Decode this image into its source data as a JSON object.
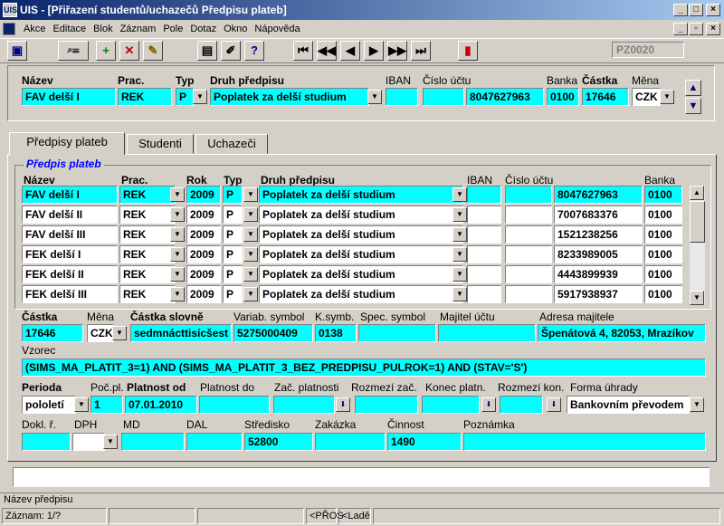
{
  "window": {
    "title": "UIS - [Přiřazení studentů/uchazečů Předpisu plateb]",
    "icon": "UIS"
  },
  "menu": [
    "Akce",
    "Editace",
    "Blok",
    "Záznam",
    "Pole",
    "Dotaz",
    "Okno",
    "Nápověda"
  ],
  "toolbar": {
    "form_code": "PZ0020"
  },
  "header": {
    "labels": {
      "nazev": "Název",
      "prac": "Prac.",
      "typ": "Typ",
      "druh": "Druh předpisu",
      "iban": "IBAN",
      "cislo": "Číslo účtu",
      "banka": "Banka",
      "castka": "Částka",
      "mena": "Měna"
    },
    "values": {
      "nazev": "FAV delší I",
      "prac": "REK",
      "typ": "P",
      "druh": "Poplatek za delší studium",
      "iban": "",
      "cislo": "8047627963",
      "banka": "0100",
      "castka": "17646",
      "mena": "CZK"
    }
  },
  "tabs": [
    "Předpisy plateb",
    "Studenti",
    "Uchazeči"
  ],
  "group_title": "Předpis plateb",
  "grid": {
    "headers": {
      "nazev": "Název",
      "prac": "Prac.",
      "rok": "Rok",
      "typ": "Typ",
      "druh": "Druh předpisu",
      "iban": "IBAN",
      "cislo": "Číslo účtu",
      "banka": "Banka"
    },
    "rows": [
      {
        "nazev": "FAV delší I",
        "prac": "REK",
        "rok": "2009",
        "typ": "P",
        "druh": "Poplatek za delší studium",
        "iban": "",
        "cislo": "8047627963",
        "banka": "0100"
      },
      {
        "nazev": "FAV delší II",
        "prac": "REK",
        "rok": "2009",
        "typ": "P",
        "druh": "Poplatek za delší studium",
        "iban": "",
        "cislo": "7007683376",
        "banka": "0100"
      },
      {
        "nazev": "FAV delší III",
        "prac": "REK",
        "rok": "2009",
        "typ": "P",
        "druh": "Poplatek za delší studium",
        "iban": "",
        "cislo": "1521238256",
        "banka": "0100"
      },
      {
        "nazev": "FEK delší I",
        "prac": "REK",
        "rok": "2009",
        "typ": "P",
        "druh": "Poplatek za delší studium",
        "iban": "",
        "cislo": "8233989005",
        "banka": "0100"
      },
      {
        "nazev": "FEK delší II",
        "prac": "REK",
        "rok": "2009",
        "typ": "P",
        "druh": "Poplatek za delší studium",
        "iban": "",
        "cislo": "4443899939",
        "banka": "0100"
      },
      {
        "nazev": "FEK delší III",
        "prac": "REK",
        "rok": "2009",
        "typ": "P",
        "druh": "Poplatek za delší studium",
        "iban": "",
        "cislo": "5917938937",
        "banka": "0100"
      }
    ]
  },
  "detail": {
    "labels": {
      "castka": "Částka",
      "mena": "Měna",
      "slovne": "Částka slovně",
      "vs": "Variab. symbol",
      "ks": "K.symb.",
      "ss": "Spec. symbol",
      "majitel": "Majitel účtu",
      "adresa": "Adresa majitele",
      "vzorec": "Vzorec",
      "perioda": "Perioda",
      "poc": "Poč.pl.",
      "platnost_od": "Platnost od",
      "platnost_do": "Platnost do",
      "zac": "Zač. platnosti",
      "rozmezi_zac": "Rozmezí zač.",
      "konec": "Konec platn.",
      "rozmezi_kon": "Rozmezí kon.",
      "forma": "Forma úhrady",
      "dokl": "Dokl. ř.",
      "dph": "DPH",
      "md": "MD",
      "dal": "DAL",
      "stredisko": "Středisko",
      "zakazka": "Zakázka",
      "cinnost": "Činnost",
      "poznamka": "Poznámka"
    },
    "values": {
      "castka": "17646",
      "mena": "CZK",
      "slovne": "sedmnácttisícšest",
      "vs": "5275000409",
      "ks": "0138",
      "ss": "",
      "majitel": "",
      "adresa": "Špenátová 4, 82053, Mrazíkov",
      "vzorec": "(SIMS_MA_PLATIT_3=1) AND (SIMS_MA_PLATIT_3_BEZ_PREDPISU_PULROK=1) AND (STAV='S')",
      "perioda": "pololetí",
      "poc": "1",
      "platnost_od": "07.01.2010",
      "platnost_do": "",
      "zac": "",
      "rozmezi_zac": "",
      "konec": "",
      "rozmezi_kon": "",
      "forma": "Bankovním převodem",
      "dokl": "",
      "dph": "",
      "md": "",
      "dal": "",
      "stredisko": "52800",
      "zakazka": "",
      "cinnost": "1490",
      "poznamka": ""
    }
  },
  "statusbar": {
    "hint": "Název předpisu",
    "zaznam": "Záznam: 1/?",
    "pros": "<PŘOS",
    "lade": "<Ladě"
  }
}
